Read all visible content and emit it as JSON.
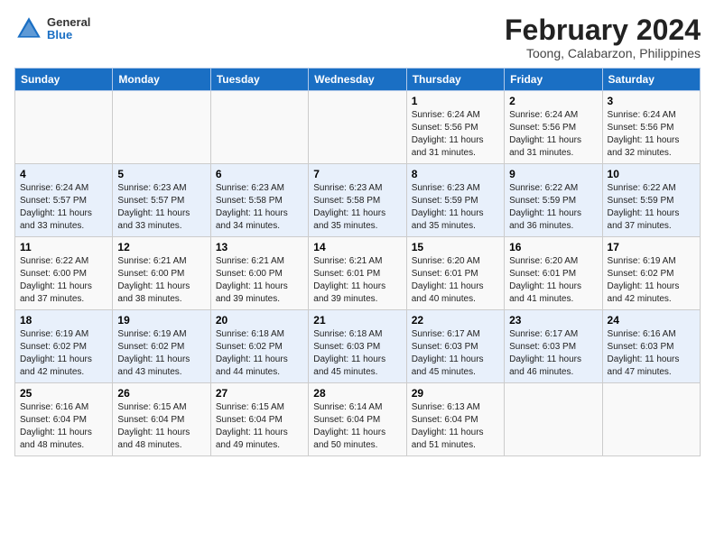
{
  "header": {
    "logo_general": "General",
    "logo_blue": "Blue",
    "title": "February 2024",
    "subtitle": "Toong, Calabarzon, Philippines"
  },
  "days_of_week": [
    "Sunday",
    "Monday",
    "Tuesday",
    "Wednesday",
    "Thursday",
    "Friday",
    "Saturday"
  ],
  "weeks": [
    [
      {
        "day": "",
        "info": ""
      },
      {
        "day": "",
        "info": ""
      },
      {
        "day": "",
        "info": ""
      },
      {
        "day": "",
        "info": ""
      },
      {
        "day": "1",
        "info": "Sunrise: 6:24 AM\nSunset: 5:56 PM\nDaylight: 11 hours and 31 minutes."
      },
      {
        "day": "2",
        "info": "Sunrise: 6:24 AM\nSunset: 5:56 PM\nDaylight: 11 hours and 31 minutes."
      },
      {
        "day": "3",
        "info": "Sunrise: 6:24 AM\nSunset: 5:56 PM\nDaylight: 11 hours and 32 minutes."
      }
    ],
    [
      {
        "day": "4",
        "info": "Sunrise: 6:24 AM\nSunset: 5:57 PM\nDaylight: 11 hours and 33 minutes."
      },
      {
        "day": "5",
        "info": "Sunrise: 6:23 AM\nSunset: 5:57 PM\nDaylight: 11 hours and 33 minutes."
      },
      {
        "day": "6",
        "info": "Sunrise: 6:23 AM\nSunset: 5:58 PM\nDaylight: 11 hours and 34 minutes."
      },
      {
        "day": "7",
        "info": "Sunrise: 6:23 AM\nSunset: 5:58 PM\nDaylight: 11 hours and 35 minutes."
      },
      {
        "day": "8",
        "info": "Sunrise: 6:23 AM\nSunset: 5:59 PM\nDaylight: 11 hours and 35 minutes."
      },
      {
        "day": "9",
        "info": "Sunrise: 6:22 AM\nSunset: 5:59 PM\nDaylight: 11 hours and 36 minutes."
      },
      {
        "day": "10",
        "info": "Sunrise: 6:22 AM\nSunset: 5:59 PM\nDaylight: 11 hours and 37 minutes."
      }
    ],
    [
      {
        "day": "11",
        "info": "Sunrise: 6:22 AM\nSunset: 6:00 PM\nDaylight: 11 hours and 37 minutes."
      },
      {
        "day": "12",
        "info": "Sunrise: 6:21 AM\nSunset: 6:00 PM\nDaylight: 11 hours and 38 minutes."
      },
      {
        "day": "13",
        "info": "Sunrise: 6:21 AM\nSunset: 6:00 PM\nDaylight: 11 hours and 39 minutes."
      },
      {
        "day": "14",
        "info": "Sunrise: 6:21 AM\nSunset: 6:01 PM\nDaylight: 11 hours and 39 minutes."
      },
      {
        "day": "15",
        "info": "Sunrise: 6:20 AM\nSunset: 6:01 PM\nDaylight: 11 hours and 40 minutes."
      },
      {
        "day": "16",
        "info": "Sunrise: 6:20 AM\nSunset: 6:01 PM\nDaylight: 11 hours and 41 minutes."
      },
      {
        "day": "17",
        "info": "Sunrise: 6:19 AM\nSunset: 6:02 PM\nDaylight: 11 hours and 42 minutes."
      }
    ],
    [
      {
        "day": "18",
        "info": "Sunrise: 6:19 AM\nSunset: 6:02 PM\nDaylight: 11 hours and 42 minutes."
      },
      {
        "day": "19",
        "info": "Sunrise: 6:19 AM\nSunset: 6:02 PM\nDaylight: 11 hours and 43 minutes."
      },
      {
        "day": "20",
        "info": "Sunrise: 6:18 AM\nSunset: 6:02 PM\nDaylight: 11 hours and 44 minutes."
      },
      {
        "day": "21",
        "info": "Sunrise: 6:18 AM\nSunset: 6:03 PM\nDaylight: 11 hours and 45 minutes."
      },
      {
        "day": "22",
        "info": "Sunrise: 6:17 AM\nSunset: 6:03 PM\nDaylight: 11 hours and 45 minutes."
      },
      {
        "day": "23",
        "info": "Sunrise: 6:17 AM\nSunset: 6:03 PM\nDaylight: 11 hours and 46 minutes."
      },
      {
        "day": "24",
        "info": "Sunrise: 6:16 AM\nSunset: 6:03 PM\nDaylight: 11 hours and 47 minutes."
      }
    ],
    [
      {
        "day": "25",
        "info": "Sunrise: 6:16 AM\nSunset: 6:04 PM\nDaylight: 11 hours and 48 minutes."
      },
      {
        "day": "26",
        "info": "Sunrise: 6:15 AM\nSunset: 6:04 PM\nDaylight: 11 hours and 48 minutes."
      },
      {
        "day": "27",
        "info": "Sunrise: 6:15 AM\nSunset: 6:04 PM\nDaylight: 11 hours and 49 minutes."
      },
      {
        "day": "28",
        "info": "Sunrise: 6:14 AM\nSunset: 6:04 PM\nDaylight: 11 hours and 50 minutes."
      },
      {
        "day": "29",
        "info": "Sunrise: 6:13 AM\nSunset: 6:04 PM\nDaylight: 11 hours and 51 minutes."
      },
      {
        "day": "",
        "info": ""
      },
      {
        "day": "",
        "info": ""
      }
    ]
  ]
}
